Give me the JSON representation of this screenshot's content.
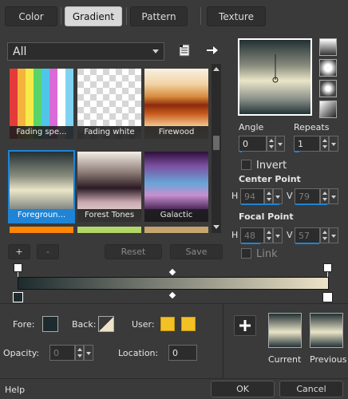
{
  "tabs": [
    {
      "label": "Color"
    },
    {
      "label": "Gradient"
    },
    {
      "label": "Pattern"
    },
    {
      "label": "Texture"
    }
  ],
  "filter": {
    "selected": "All"
  },
  "gradients": [
    {
      "name": "Fading spe...",
      "style": "repeating-linear-gradient(90deg,#e53a3a 0 10px,#f4b33d 10px 20px,#f5ea48 20px 30px,#58d46a 30px 40px,#4fc6e8 40px 50px,#d96ad6 50px 60px,#ffffff 60px 70px,#7fd3f0 70px 80px)"
    },
    {
      "name": "Fading white",
      "style": "repeating-conic-gradient(#ffffff 0 25%,#d6d6d6 0 50%) 0 0/16px 16px"
    },
    {
      "name": "Firewood",
      "style": "linear-gradient(#f7f1e2 0%,#f2d3a5 22%,#d88b3d 40%,#8b2b0d 52%,#c75a1d 64%,#f2c892 82%,#faf4ea 100%)"
    },
    {
      "name": "Foregroun...",
      "style": "linear-gradient(#223033 0%,#8a8d7e 35%,#eae5c8 55%,#8a9088 80%,#223236 100%)"
    },
    {
      "name": "Forest Tones",
      "style": "linear-gradient(#f4efe6 0%,#8c7a75 30%,#2a1a24 52%,#c9a9b0 72%,#f6f1e9 100%)"
    },
    {
      "name": "Galactic",
      "style": "linear-gradient(#2e0f3a 0%,#7b4fa0 20%,#68a6d8 45%,#c88fcf 62%,#3a1a4a 85%,#1a0b22 100%)"
    },
    {
      "name": "",
      "style": "linear-gradient(#ff8a00,#ff3a3a)"
    },
    {
      "name": "",
      "style": "linear-gradient(#b7d96b,#6aa832)"
    },
    {
      "name": "",
      "style": "linear-gradient(#c4a36b,#e8d6a8)"
    }
  ],
  "style_icons": [
    "linear-gradient-icon",
    "rectangular-gradient-icon",
    "sunburst-gradient-icon",
    "radial-gradient-icon"
  ],
  "angle": {
    "label": "Angle",
    "value": "0"
  },
  "repeats": {
    "label": "Repeats",
    "value": "1"
  },
  "invert": {
    "label": "Invert"
  },
  "center_point": {
    "label": "Center Point",
    "h_label": "H",
    "h_value": "94",
    "v_label": "V",
    "v_value": "79"
  },
  "focal_point": {
    "label": "Focal Point",
    "h_label": "H",
    "h_value": "48",
    "v_label": "V",
    "v_value": "57"
  },
  "link": {
    "label": "Link"
  },
  "editor": {
    "add": "+",
    "remove": "-",
    "reset": "Reset",
    "save": "Save"
  },
  "gradient_bar": {
    "start": "#1d2b2e",
    "end": "#ede3c8"
  },
  "fore": {
    "label": "Fore:"
  },
  "back": {
    "label": "Back:"
  },
  "user": {
    "label": "User:"
  },
  "opacity": {
    "label": "Opacity:",
    "value": "0"
  },
  "location": {
    "label": "Location:",
    "value": "0"
  },
  "preview": {
    "current": "Current",
    "previous": "Previous"
  },
  "footer": {
    "help": "Help",
    "ok": "OK",
    "cancel": "Cancel"
  },
  "colors": {
    "accent": "#1f84d6",
    "user_swatch": "#f4c125"
  }
}
